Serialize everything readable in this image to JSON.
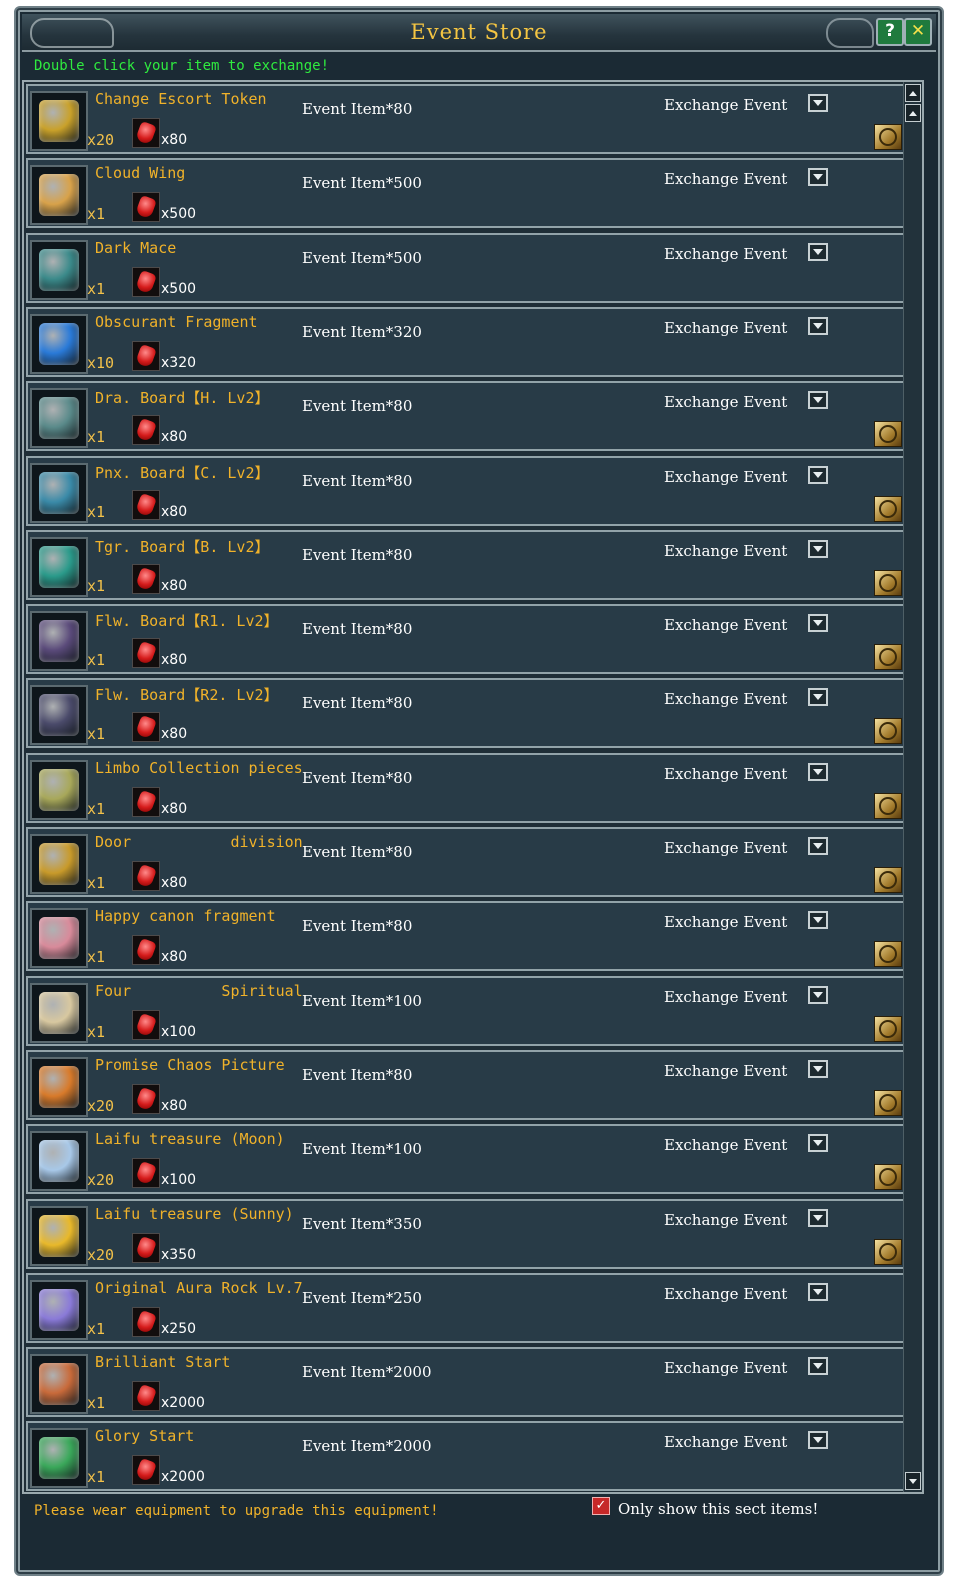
{
  "window": {
    "title": "Event Store",
    "help_label": "?",
    "close_label": "✕"
  },
  "instruction": "Double click your item to exchange!",
  "items": [
    {
      "name": "Change Escort Token",
      "qty": "x20",
      "cost_qty": "x80",
      "price": "Event Item*80",
      "exchange": "Exchange Event",
      "icon": "escort-token-icon",
      "upgradable": true,
      "color": "#c9a12a"
    },
    {
      "name": "Cloud Wing",
      "qty": "x1",
      "cost_qty": "x500",
      "price": "Event Item*500",
      "exchange": "Exchange Event",
      "icon": "cloud-wing-icon",
      "upgradable": false,
      "color": "#d8a24a"
    },
    {
      "name": "Dark Mace",
      "qty": "x1",
      "cost_qty": "x500",
      "price": "Event Item*500",
      "exchange": "Exchange Event",
      "icon": "dark-mace-icon",
      "upgradable": false,
      "color": "#3b8a8a"
    },
    {
      "name": "Obscurant Fragment",
      "qty": "x10",
      "cost_qty": "x320",
      "price": "Event Item*320",
      "exchange": "Exchange Event",
      "icon": "blue-crystal-icon",
      "upgradable": false,
      "color": "#2a7ad8"
    },
    {
      "name": "Dra. Board【H. Lv2】",
      "qty": "x1",
      "cost_qty": "x80",
      "price": "Event Item*80",
      "exchange": "Exchange Event",
      "icon": "dragon-board-icon",
      "upgradable": true,
      "color": "#5a8a8a"
    },
    {
      "name": "Pnx. Board【C. Lv2】",
      "qty": "x1",
      "cost_qty": "x80",
      "price": "Event Item*80",
      "exchange": "Exchange Event",
      "icon": "phoenix-board-icon",
      "upgradable": true,
      "color": "#3a8aa8"
    },
    {
      "name": "Tgr. Board【B. Lv2】",
      "qty": "x1",
      "cost_qty": "x80",
      "price": "Event Item*80",
      "exchange": "Exchange Event",
      "icon": "tiger-board-icon",
      "upgradable": true,
      "color": "#2a9a8a"
    },
    {
      "name": "Flw. Board【R1. Lv2】",
      "qty": "x1",
      "cost_qty": "x80",
      "price": "Event Item*80",
      "exchange": "Exchange Event",
      "icon": "flower-board-icon",
      "upgradable": true,
      "color": "#5a4a7a"
    },
    {
      "name": "Flw. Board【R2. Lv2】",
      "qty": "x1",
      "cost_qty": "x80",
      "price": "Event Item*80",
      "exchange": "Exchange Event",
      "icon": "flower-board-icon",
      "upgradable": true,
      "color": "#4a4a6a"
    },
    {
      "name": "Limbo Collection pieces",
      "qty": "x1",
      "cost_qty": "x80",
      "price": "Event Item*80",
      "exchange": "Exchange Event",
      "icon": "collection-pieces-icon",
      "upgradable": true,
      "color": "#a8a85a"
    },
    {
      "name": "Door           division",
      "qty": "x1",
      "cost_qty": "x80",
      "price": "Event Item*80",
      "exchange": "Exchange Event",
      "icon": "door-scroll-icon",
      "upgradable": true,
      "color": "#c89a2a"
    },
    {
      "name": "Happy canon fragment",
      "qty": "x1",
      "cost_qty": "x80",
      "price": "Event Item*80",
      "exchange": "Exchange Event",
      "icon": "canon-fragment-icon",
      "upgradable": true,
      "color": "#d88a9a"
    },
    {
      "name": "Four          Spiritual",
      "qty": "x1",
      "cost_qty": "x100",
      "price": "Event Item*100",
      "exchange": "Exchange Event",
      "icon": "spiritual-scroll-icon",
      "upgradable": true,
      "color": "#d8c8a0"
    },
    {
      "name": "Promise Chaos Picture",
      "qty": "x20",
      "cost_qty": "x80",
      "price": "Event Item*80",
      "exchange": "Exchange Event",
      "icon": "chaos-picture-icon",
      "upgradable": true,
      "color": "#d87a2a"
    },
    {
      "name": "Laifu treasure (Moon)",
      "qty": "x20",
      "cost_qty": "x100",
      "price": "Event Item*100",
      "exchange": "Exchange Event",
      "icon": "moon-scroll-icon",
      "upgradable": true,
      "color": "#a8c8e8"
    },
    {
      "name": "Laifu treasure (Sunny)",
      "qty": "x20",
      "cost_qty": "x350",
      "price": "Event Item*350",
      "exchange": "Exchange Event",
      "icon": "sunny-scroll-icon",
      "upgradable": true,
      "color": "#e8b82a"
    },
    {
      "name": "Original Aura Rock Lv.7",
      "qty": "x1",
      "cost_qty": "x250",
      "price": "Event Item*250",
      "exchange": "Exchange Event",
      "icon": "aura-rock-icon",
      "upgradable": false,
      "color": "#8a7ad8"
    },
    {
      "name": "Brilliant Start",
      "qty": "x1",
      "cost_qty": "x2000",
      "price": "Event Item*2000",
      "exchange": "Exchange Event",
      "icon": "brilliant-ring-icon",
      "upgradable": false,
      "color": "#c86a3a"
    },
    {
      "name": "Glory Start",
      "qty": "x1",
      "cost_qty": "x2000",
      "price": "Event Item*2000",
      "exchange": "Exchange Event",
      "icon": "glory-ring-icon",
      "upgradable": false,
      "color": "#3aa85a"
    }
  ],
  "footer": {
    "note": "Please wear equipment to upgrade this equipment!",
    "filter_checked": true,
    "filter_check_glyph": "✓",
    "filter_label": "Only show this sect items!"
  }
}
